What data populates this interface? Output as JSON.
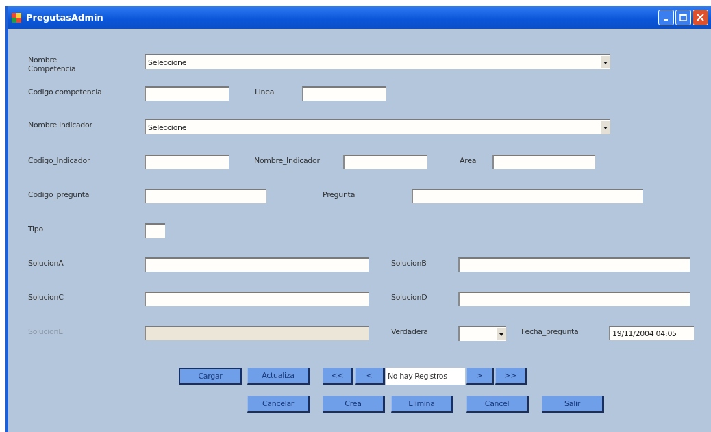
{
  "window": {
    "title": "PregutasAdmin"
  },
  "rows": [
    {
      "items": [
        {
          "kind": "label",
          "text": "Nombre Competencia",
          "disabled": false
        },
        {
          "kind": "combo",
          "value": "Seleccione",
          "disabled": false
        }
      ]
    },
    {
      "items": [
        {
          "kind": "label",
          "text": "Codigo competencia",
          "disabled": false
        },
        {
          "kind": "text",
          "disabled": false
        },
        {
          "kind": "label",
          "text": "Linea",
          "disabled": false
        },
        {
          "kind": "text",
          "disabled": false
        }
      ]
    },
    {
      "items": [
        {
          "kind": "label",
          "text": "Nombre Indicador",
          "disabled": false
        },
        {
          "kind": "combo",
          "value": "Seleccione",
          "disabled": false
        }
      ]
    },
    {
      "items": [
        {
          "kind": "label",
          "text": "Codigo_Indicador",
          "disabled": false
        },
        {
          "kind": "text",
          "disabled": false
        },
        {
          "kind": "label",
          "text": "Nombre_Indicador",
          "disabled": false
        },
        {
          "kind": "text",
          "disabled": false
        },
        {
          "kind": "label",
          "text": "Area",
          "disabled": false
        },
        {
          "kind": "text",
          "disabled": false
        }
      ]
    },
    {
      "items": [
        {
          "kind": "label",
          "text": "Codigo_pregunta",
          "disabled": false
        },
        {
          "kind": "text",
          "disabled": false
        },
        {
          "kind": "label",
          "text": "Pregunta",
          "disabled": false
        },
        {
          "kind": "text",
          "disabled": false
        }
      ]
    },
    {
      "items": [
        {
          "kind": "label",
          "text": "Tipo",
          "disabled": false
        },
        {
          "kind": "text",
          "disabled": false
        }
      ]
    },
    {
      "items": [
        {
          "kind": "label",
          "text": "SolucionA",
          "disabled": false
        },
        {
          "kind": "text",
          "disabled": false
        },
        {
          "kind": "label",
          "text": "SolucionB",
          "disabled": false
        },
        {
          "kind": "text",
          "disabled": false
        }
      ]
    },
    {
      "items": [
        {
          "kind": "label",
          "text": "SolucionC",
          "disabled": false
        },
        {
          "kind": "text",
          "disabled": false
        },
        {
          "kind": "label",
          "text": "SolucionD",
          "disabled": false
        },
        {
          "kind": "text",
          "disabled": false
        }
      ]
    },
    {
      "items": [
        {
          "kind": "label",
          "text": "SolucionE",
          "disabled": true
        },
        {
          "kind": "text",
          "disabled": true
        },
        {
          "kind": "label",
          "text": "Verdadera",
          "disabled": false
        },
        {
          "kind": "combo",
          "disabled": false
        },
        {
          "kind": "label",
          "text": "Fecha_pregunta",
          "disabled": false
        },
        {
          "kind": "text",
          "value": "19/11/2004 04:05",
          "disabled": false
        }
      ]
    }
  ],
  "button_rows": [
    [
      {
        "kind": "button",
        "label": "Cargar",
        "default": true
      },
      {
        "kind": "button",
        "label": "Actualiza",
        "default": false
      },
      {
        "kind": "button",
        "label": "<<",
        "default": false
      },
      {
        "kind": "button",
        "label": "<",
        "default": false
      },
      {
        "kind": "status",
        "text": "No hay Registros"
      },
      {
        "kind": "button",
        "label": ">",
        "default": false
      },
      {
        "kind": "button",
        "label": ">>",
        "default": false
      }
    ],
    [
      {
        "kind": "button",
        "label": "Cancelar",
        "default": false
      },
      {
        "kind": "button",
        "label": "Crea",
        "default": false
      },
      {
        "kind": "button",
        "label": "Elimina",
        "default": false
      },
      {
        "kind": "button",
        "label": "Cancel",
        "default": false
      },
      {
        "kind": "button",
        "label": "Salir",
        "default": false
      }
    ]
  ]
}
